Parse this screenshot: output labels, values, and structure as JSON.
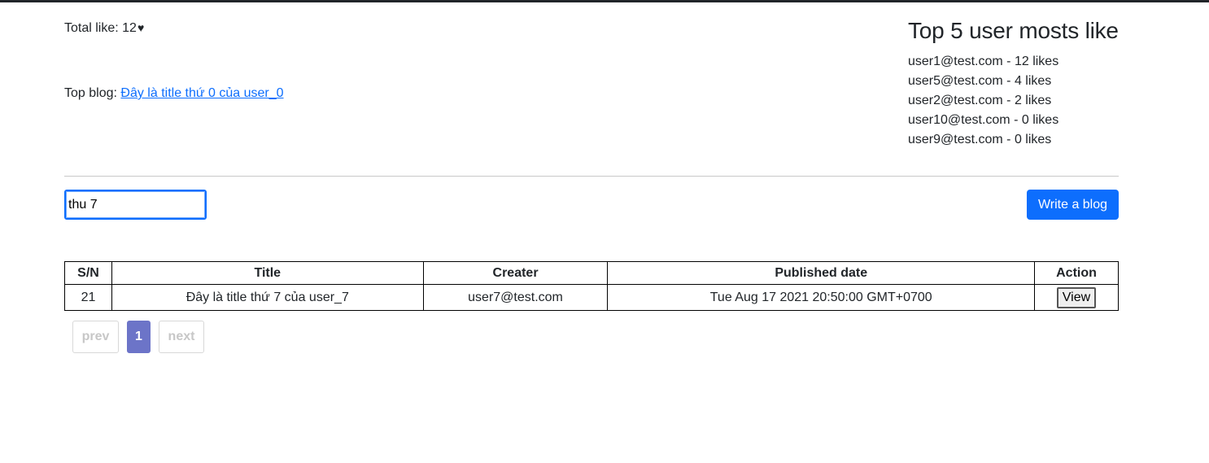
{
  "stats": {
    "total_like_label": "Total like: 12",
    "heart_icon": "♥",
    "top_blog_label": "Top blog: ",
    "top_blog_link": "Đây là title thứ 0 của user_0"
  },
  "top_users": {
    "title": "Top 5 user mosts like",
    "items": [
      "user1@test.com - 12 likes",
      "user5@test.com - 4 likes",
      "user2@test.com - 2 likes",
      "user10@test.com - 0 likes",
      "user9@test.com - 0 likes"
    ]
  },
  "search": {
    "value": "thu 7"
  },
  "write_button": "Write a blog",
  "table": {
    "headers": [
      "S/N",
      "Title",
      "Creater",
      "Published date",
      "Action"
    ],
    "rows": [
      {
        "sn": "21",
        "title": "Đây là title thứ 7 của user_7",
        "creator": "user7@test.com",
        "published": "Tue Aug 17 2021 20:50:00 GMT+0700",
        "action": "View"
      }
    ]
  },
  "pagination": {
    "prev": "prev",
    "page": "1",
    "next": "next"
  },
  "colors": {
    "primary": "#0d6efd",
    "active_page": "#6c74c8",
    "disabled_text": "#c7c7c7"
  }
}
